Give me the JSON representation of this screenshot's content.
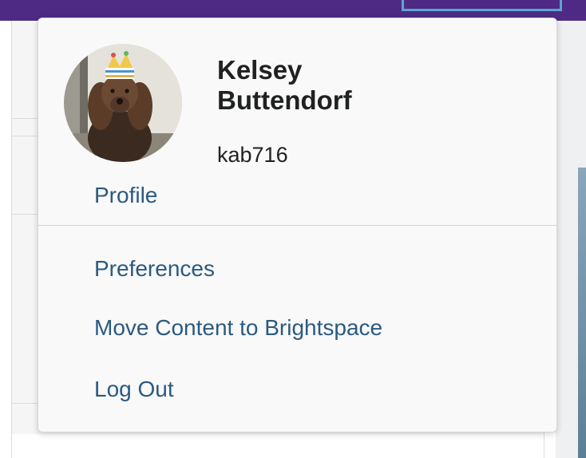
{
  "user": {
    "name": "Kelsey Buttendorf",
    "username": "kab716",
    "avatar_icon": "dog-photo-avatar"
  },
  "menu": {
    "profile_label": "Profile",
    "items": [
      {
        "label": "Preferences"
      },
      {
        "label": "Move Content to Brightspace"
      },
      {
        "label": "Log Out"
      }
    ]
  },
  "colors": {
    "topbar": "#4e2a84",
    "link": "#2b5a80",
    "focus_outline": "#5aa6cf"
  }
}
